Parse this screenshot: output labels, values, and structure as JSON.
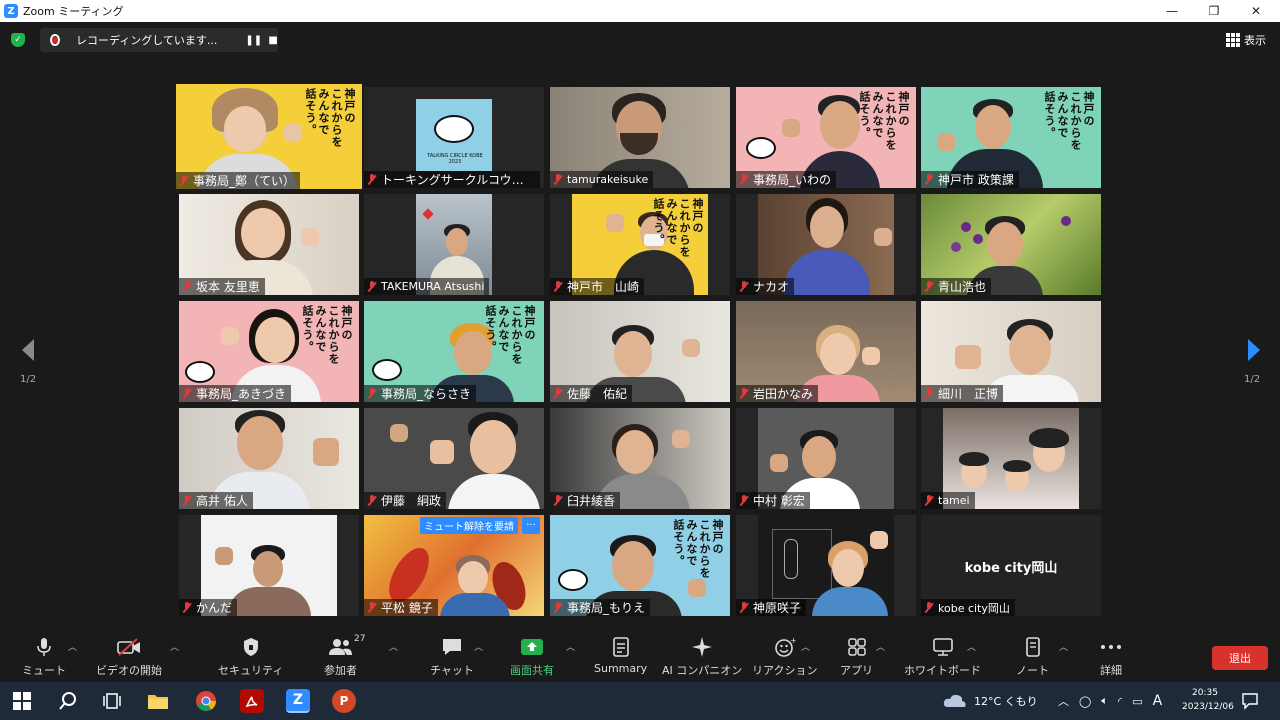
{
  "window": {
    "title": "Zoom ミーティング",
    "minimize": "—",
    "maximize": "❐",
    "close": "✕"
  },
  "recording": {
    "text": "レコーディングしています...",
    "pause": "❚❚",
    "stop": "■"
  },
  "view_label": "表示",
  "page_indicator": "1/2",
  "participants": [
    {
      "name": "事務局_鄭（てい）"
    },
    {
      "name": "トーキングサークルコウベ事..."
    },
    {
      "name": "tamurakeisuke"
    },
    {
      "name": "事務局_いわの"
    },
    {
      "name": "神戸市 政策課"
    },
    {
      "name": "坂本 友里恵"
    },
    {
      "name": "TAKEMURA Atsushi"
    },
    {
      "name": "神戸市　山崎"
    },
    {
      "name": "ナカオ"
    },
    {
      "name": "青山浩也"
    },
    {
      "name": "事務局_あきづき"
    },
    {
      "name": "事務局_ならさき"
    },
    {
      "name": "佐藤　佑紀"
    },
    {
      "name": "岩田かなみ"
    },
    {
      "name": "細川　正博"
    },
    {
      "name": "高井 佑人"
    },
    {
      "name": "伊藤　絅政"
    },
    {
      "name": "臼井綾香"
    },
    {
      "name": "中村 彰宏"
    },
    {
      "name": "tamei"
    },
    {
      "name": "かんだ"
    },
    {
      "name": "平松 鏡子"
    },
    {
      "name": "事務局_もりえ"
    },
    {
      "name": "神原咲子"
    },
    {
      "name": "kobe city岡山"
    }
  ],
  "poster_text": "神戸の\nこれからを\nみんなで\n話そう。",
  "logo_text": "TALKING CIRCLE KOBE 2023",
  "unmute_request": "ミュート解除を要請",
  "more_options": "···",
  "toolbar": {
    "mute": "ミュート",
    "video_start": "ビデオの開始",
    "security": "セキュリティ",
    "participants": "参加者",
    "participants_count": "27",
    "chat": "チャット",
    "share_screen": "画面共有",
    "summary": "Summary",
    "ai_companion": "AI コンパニオン",
    "reactions": "リアクション",
    "apps": "アプリ",
    "whiteboard": "ホワイトボード",
    "notes": "ノート",
    "more": "詳細",
    "leave": "退出"
  },
  "taskbar": {
    "weather": "12°C くもり",
    "time": "20:35",
    "date": "2023/12/06",
    "ime": "A"
  },
  "colors": {
    "accent_blue": "#2d8cff",
    "leave_red": "#d9312c",
    "active_speaker": "#f3e34a",
    "share_green": "#23b14d"
  }
}
